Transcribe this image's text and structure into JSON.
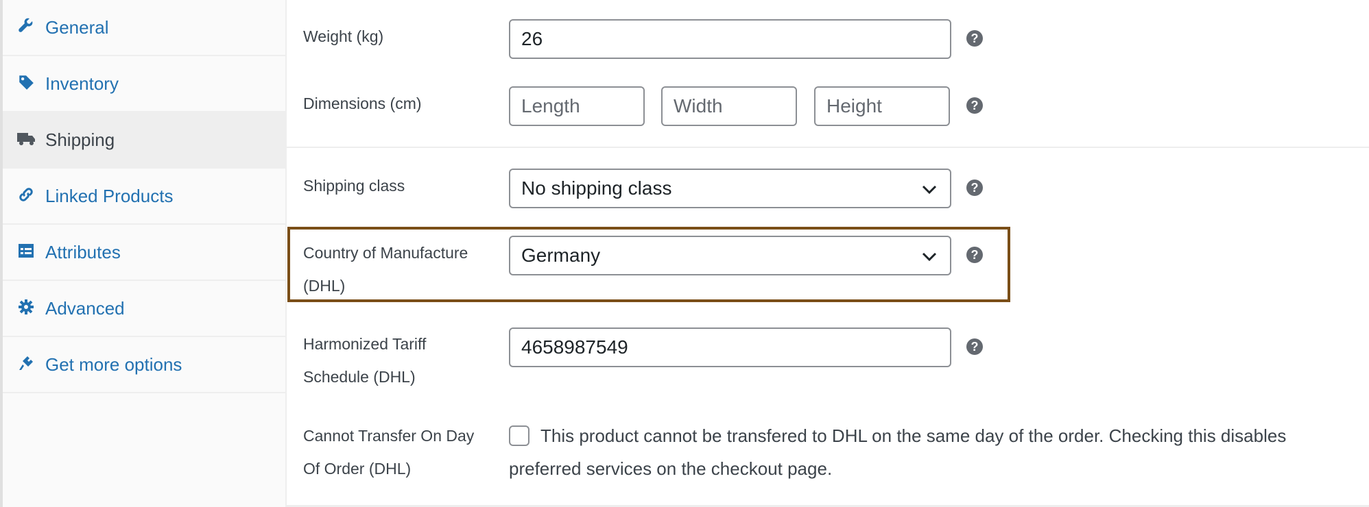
{
  "sidebar": {
    "items": [
      {
        "label": "General",
        "icon": "wrench-icon"
      },
      {
        "label": "Inventory",
        "icon": "tag-icon"
      },
      {
        "label": "Shipping",
        "icon": "truck-icon",
        "active": true
      },
      {
        "label": "Linked Products",
        "icon": "link-icon"
      },
      {
        "label": "Attributes",
        "icon": "list-icon"
      },
      {
        "label": "Advanced",
        "icon": "gear-icon"
      },
      {
        "label": "Get more options",
        "icon": "plug-icon"
      }
    ]
  },
  "shipping": {
    "weight": {
      "label": "Weight (kg)",
      "value": "26"
    },
    "dimensions": {
      "label": "Dimensions (cm)",
      "length_placeholder": "Length",
      "width_placeholder": "Width",
      "height_placeholder": "Height"
    },
    "shipping_class": {
      "label": "Shipping class",
      "value": "No shipping class"
    },
    "country_of_manufacture": {
      "label_line1": "Country of Manufacture",
      "label_line2": "(DHL)",
      "value": "Germany"
    },
    "hts": {
      "label_line1": "Harmonized Tariff",
      "label_line2": "Schedule (DHL)",
      "value": "4658987549"
    },
    "cannot_transfer": {
      "label_line1": "Cannot Transfer On Day",
      "label_line2": "Of Order (DHL)",
      "description": "This product cannot be transfered to DHL on the same day of the order. Checking this disables preferred services on the checkout page.",
      "checked": false
    },
    "help_glyph": "?"
  },
  "colors": {
    "link": "#2271b1",
    "highlight_border": "#7a4e17",
    "help_bg": "#646970"
  }
}
